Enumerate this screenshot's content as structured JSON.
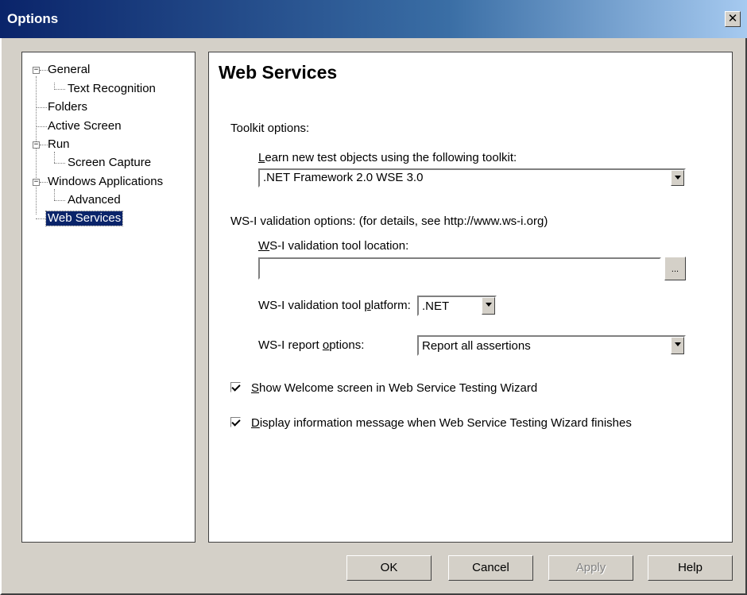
{
  "window": {
    "title": "Options",
    "close_symbol": "✕"
  },
  "tree": {
    "items": [
      {
        "label": "General",
        "expander": "−"
      },
      {
        "label": "Text Recognition"
      },
      {
        "label": "Folders"
      },
      {
        "label": "Active Screen"
      },
      {
        "label": "Run",
        "expander": "−"
      },
      {
        "label": "Screen Capture"
      },
      {
        "label": "Windows Applications",
        "expander": "−"
      },
      {
        "label": "Advanced"
      },
      {
        "label": "Web Services",
        "selected": true
      }
    ]
  },
  "panel": {
    "heading": "Web Services",
    "toolkit_options_label": "Toolkit options:",
    "learn_label_first": "L",
    "learn_label_rest": "earn new test objects using the following toolkit:",
    "toolkit_value": ".NET Framework 2.0 WSE 3.0",
    "wsi_options_label": "WS-I validation options: (for details, see http://www.ws-i.org)",
    "tool_location_first": "W",
    "tool_location_rest": "S-I validation tool location:",
    "tool_location_value": "",
    "browse_label": "...",
    "platform_label_pre": "WS-I validation tool ",
    "platform_label_u": "p",
    "platform_label_post": "latform:",
    "platform_value": ".NET",
    "report_label_pre": "WS-I report ",
    "report_label_u": "o",
    "report_label_post": "ptions:",
    "report_value": "Report all assertions",
    "show_welcome_first": "S",
    "show_welcome_rest": "how Welcome screen in Web Service Testing Wizard",
    "show_welcome_checked": true,
    "display_info_first": "D",
    "display_info_rest": "isplay information message when Web Service Testing Wizard finishes",
    "display_info_checked": true
  },
  "buttons": {
    "ok": "OK",
    "cancel": "Cancel",
    "apply": "Apply",
    "help": "Help"
  }
}
